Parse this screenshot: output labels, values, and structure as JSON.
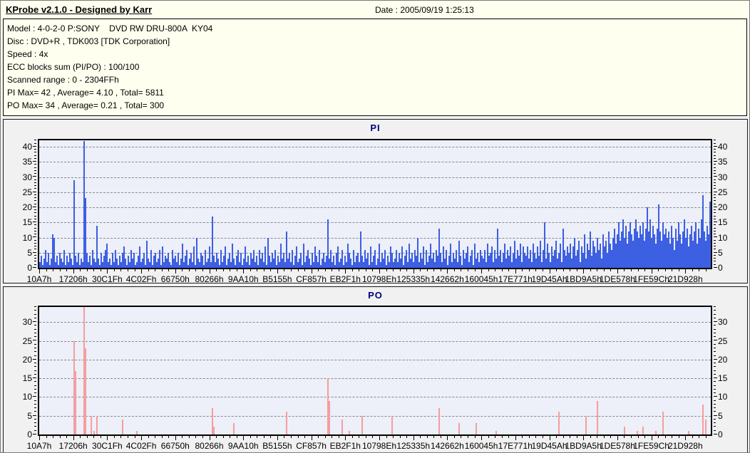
{
  "header": {
    "app_title": "KProbe v2.1.0 - Designed by Karr",
    "date_label": "Date : 2005/09/19 1:25:13"
  },
  "info": {
    "lines": [
      "Model : 4-0-2-0 P:SONY    DVD RW DRU-800A  KY04",
      "Disc : DVD+R , TDK003 [TDK Corporation]",
      "Speed : 4x",
      "ECC blocks sum (PI/PO) : 100/100",
      "Scanned range : 0 - 2304FFh",
      "PI Max= 42 , Average= 4.10 , Total= 5811",
      "PO Max= 34 , Average= 0.21 , Total= 300"
    ]
  },
  "colors": {
    "background_ivory": "#FFFFEF",
    "panel_gray": "#F1F1F1",
    "plot_background": "#EDEFF9",
    "gridline": "#8A8A8A",
    "pi_bar": "#3D5FE1",
    "po_bar": "#F59E9E",
    "chart_title": "#000080"
  },
  "chart_data": [
    {
      "type": "bar",
      "title": "PI",
      "color": "#3D5FE1",
      "ylim": [
        0,
        42
      ],
      "yticks": [
        0,
        5,
        10,
        15,
        20,
        25,
        30,
        35,
        40
      ],
      "grid": "dashed-horizontal",
      "stats": {
        "max": 42,
        "average": 4.1,
        "total": 5811
      },
      "x_tick_labels": [
        "10A7h",
        "17206h",
        "30C1Fh",
        "4C02Fh",
        "66750h",
        "80266h",
        "9AA10h",
        "B5155h",
        "CF857h",
        "EB2F1h",
        "10798Eh",
        "125335h",
        "142662h",
        "160045h",
        "17E771h",
        "19D45Ah",
        "1BD9A5h",
        "1DE578h",
        "1FE59Ch",
        "21D928h"
      ],
      "values": [
        2,
        4,
        1,
        3,
        6,
        2,
        5,
        1,
        3,
        11,
        10,
        2,
        4,
        1,
        5,
        3,
        2,
        6,
        1,
        4,
        2,
        5,
        3,
        1,
        29,
        4,
        2,
        5,
        1,
        3,
        2,
        42,
        23,
        5,
        2,
        4,
        1,
        6,
        3,
        2,
        14,
        3,
        1,
        5,
        2,
        4,
        6,
        8,
        2,
        3,
        1,
        5,
        2,
        6,
        3,
        1,
        4,
        2,
        5,
        7,
        3,
        1,
        4,
        2,
        6,
        3,
        5,
        1,
        2,
        4,
        7,
        2,
        3,
        5,
        1,
        9,
        3,
        2,
        6,
        1,
        4,
        5,
        2,
        3,
        6,
        1,
        7,
        2,
        4,
        3,
        5,
        2,
        1,
        6,
        3,
        4,
        2,
        5,
        1,
        3,
        8,
        2,
        4,
        6,
        1,
        3,
        5,
        2,
        7,
        1,
        10,
        3,
        2,
        5,
        4,
        1,
        6,
        2,
        3,
        7,
        2,
        17,
        4,
        2,
        5,
        3,
        1,
        6,
        2,
        4,
        7,
        1,
        3,
        5,
        2,
        8,
        3,
        1,
        4,
        6,
        2,
        5,
        1,
        3,
        7,
        2,
        4,
        1,
        5,
        3,
        6,
        2,
        4,
        1,
        6,
        3,
        5,
        2,
        7,
        1,
        10,
        4,
        2,
        5,
        3,
        6,
        1,
        4,
        2,
        8,
        3,
        5,
        2,
        12,
        3,
        5,
        2,
        6,
        1,
        4,
        7,
        2,
        3,
        5,
        1,
        8,
        2,
        4,
        6,
        3,
        1,
        5,
        2,
        7,
        4,
        2,
        6,
        1,
        3,
        5,
        2,
        4,
        16,
        3,
        6,
        2,
        4,
        1,
        5,
        7,
        2,
        3,
        6,
        1,
        4,
        2,
        8,
        5,
        3,
        1,
        6,
        2,
        4,
        5,
        2,
        12,
        4,
        2,
        6,
        3,
        5,
        1,
        7,
        2,
        4,
        6,
        1,
        3,
        8,
        2,
        5,
        3,
        6,
        1,
        4,
        2,
        7,
        5,
        2,
        3,
        6,
        2,
        5,
        3,
        7,
        1,
        4,
        6,
        2,
        8,
        3,
        5,
        2,
        6,
        4,
        10,
        2,
        5,
        3,
        7,
        1,
        6,
        2,
        4,
        8,
        3,
        5,
        2,
        6,
        4,
        13,
        5,
        2,
        7,
        3,
        6,
        1,
        4,
        8,
        2,
        5,
        3,
        6,
        2,
        9,
        4,
        1,
        6,
        3,
        5,
        7,
        2,
        4,
        6,
        1,
        8,
        3,
        5,
        2,
        6,
        4,
        3,
        6,
        2,
        8,
        4,
        5,
        7,
        2,
        6,
        3,
        13,
        4,
        6,
        2,
        5,
        8,
        3,
        6,
        4,
        7,
        2,
        5,
        9,
        3,
        6,
        4,
        8,
        2,
        7,
        5,
        4,
        7,
        3,
        6,
        2,
        8,
        5,
        3,
        7,
        4,
        9,
        2,
        6,
        15,
        3,
        8,
        5,
        2,
        7,
        4,
        6,
        9,
        3,
        5,
        8,
        2,
        13,
        6,
        4,
        7,
        5,
        8,
        3,
        7,
        10,
        4,
        6,
        9,
        2,
        7,
        5,
        11,
        3,
        8,
        6,
        12,
        4,
        9,
        7,
        5,
        10,
        6,
        8,
        3,
        11,
        7,
        9,
        5,
        12,
        8,
        6,
        10,
        13,
        8,
        11,
        15,
        9,
        12,
        16,
        10,
        14,
        8,
        12,
        15,
        11,
        9,
        13,
        16,
        12,
        10,
        14,
        11,
        15,
        9,
        13,
        20,
        12,
        16,
        10,
        14,
        11,
        8,
        13,
        21,
        12,
        9,
        15,
        11,
        13,
        10,
        12,
        8,
        14,
        10,
        6,
        13,
        9,
        15,
        11,
        8,
        12,
        16,
        10,
        13,
        7,
        11,
        14,
        9,
        12,
        15,
        8,
        13,
        10,
        16,
        24,
        12,
        9,
        14,
        11,
        22
      ]
    },
    {
      "type": "bar",
      "title": "PO",
      "color": "#F59E9E",
      "ylim": [
        0,
        34
      ],
      "yticks": [
        0,
        5,
        10,
        15,
        20,
        25,
        30
      ],
      "grid": "dashed-horizontal",
      "stats": {
        "max": 34,
        "average": 0.21,
        "total": 300
      },
      "x_tick_labels": [
        "10A7h",
        "17206h",
        "30C1Fh",
        "4C02Fh",
        "66750h",
        "80266h",
        "9AA10h",
        "B5155h",
        "CF857h",
        "EB2F1h",
        "10798Eh",
        "125335h",
        "142662h",
        "160045h",
        "17E771h",
        "19D45Ah",
        "1BD9A5h",
        "1DE578h",
        "1FE59Ch",
        "21D928h"
      ],
      "n_points": 471,
      "spikes": [
        [
          24,
          25
        ],
        [
          25,
          17
        ],
        [
          31,
          34
        ],
        [
          32,
          23
        ],
        [
          36,
          5
        ],
        [
          38,
          1
        ],
        [
          40,
          5
        ],
        [
          58,
          4
        ],
        [
          68,
          1
        ],
        [
          121,
          7
        ],
        [
          122,
          2
        ],
        [
          136,
          3
        ],
        [
          173,
          6
        ],
        [
          202,
          15
        ],
        [
          203,
          9
        ],
        [
          212,
          4
        ],
        [
          217,
          1
        ],
        [
          226,
          5
        ],
        [
          247,
          5
        ],
        [
          280,
          7
        ],
        [
          294,
          3
        ],
        [
          306,
          3
        ],
        [
          320,
          1
        ],
        [
          364,
          6
        ],
        [
          383,
          5
        ],
        [
          391,
          9
        ],
        [
          410,
          2
        ],
        [
          419,
          1
        ],
        [
          423,
          2
        ],
        [
          432,
          1
        ],
        [
          437,
          6
        ],
        [
          455,
          1
        ],
        [
          465,
          8
        ],
        [
          467,
          4
        ]
      ]
    }
  ]
}
